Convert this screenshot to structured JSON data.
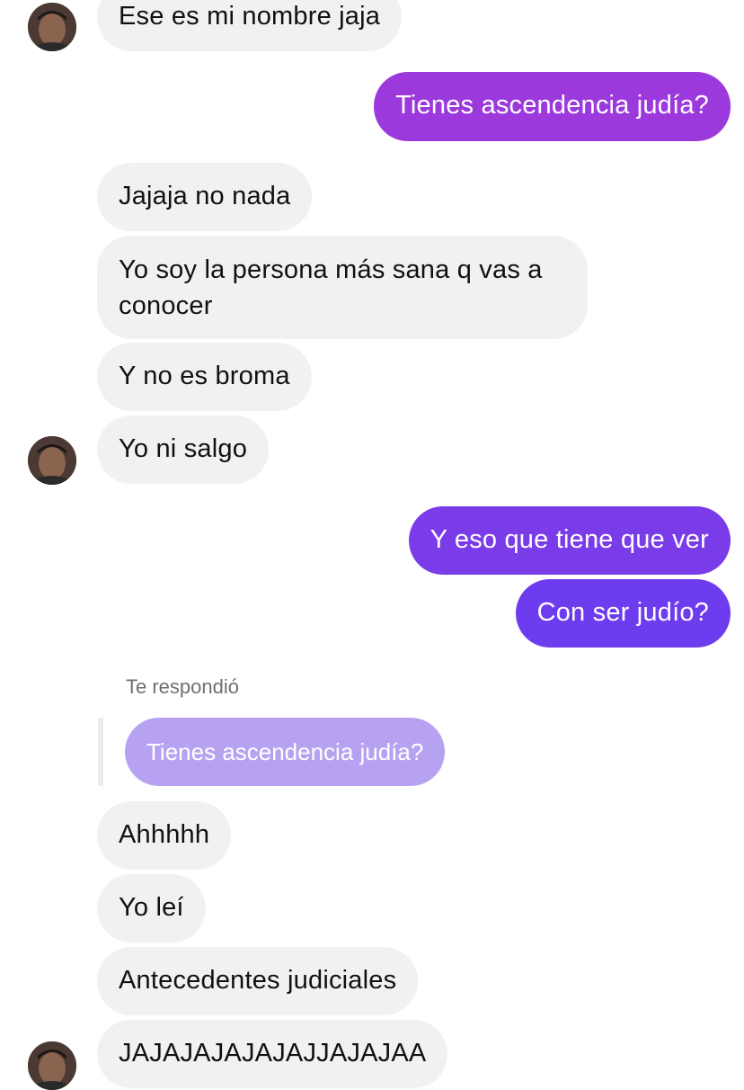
{
  "colors": {
    "received_bubble": "#f1f1f3",
    "sent_gradient_top": "#9b3ae0",
    "sent_gradient_bottom": "#6c3cf0",
    "quoted_bubble": "#b7a2f2"
  },
  "icons": {
    "avatar": "contact-avatar-photo"
  },
  "messages": [
    {
      "from": "them",
      "text": "Ese es mi nombre jaja"
    },
    {
      "from": "me",
      "text": "Tienes ascendencia judía?"
    },
    {
      "from": "them",
      "text": "Jajaja no nada"
    },
    {
      "from": "them",
      "text": "Yo soy la persona más sana q vas a conocer"
    },
    {
      "from": "them",
      "text": "Y no es broma"
    },
    {
      "from": "them",
      "text": "Yo ni salgo"
    },
    {
      "from": "me",
      "text": "Y eso que tiene que ver"
    },
    {
      "from": "me",
      "text": "Con ser judío?"
    },
    {
      "from": "them",
      "text": "Ahhhhh"
    },
    {
      "from": "them",
      "text": "Yo leí"
    },
    {
      "from": "them",
      "text": "Antecedentes judiciales"
    },
    {
      "from": "them",
      "text": "JAJAJAJAJAJAJJAJAJAA"
    }
  ],
  "reply": {
    "label": "Te respondió",
    "quoted_text": "Tienes ascendencia judía?"
  }
}
